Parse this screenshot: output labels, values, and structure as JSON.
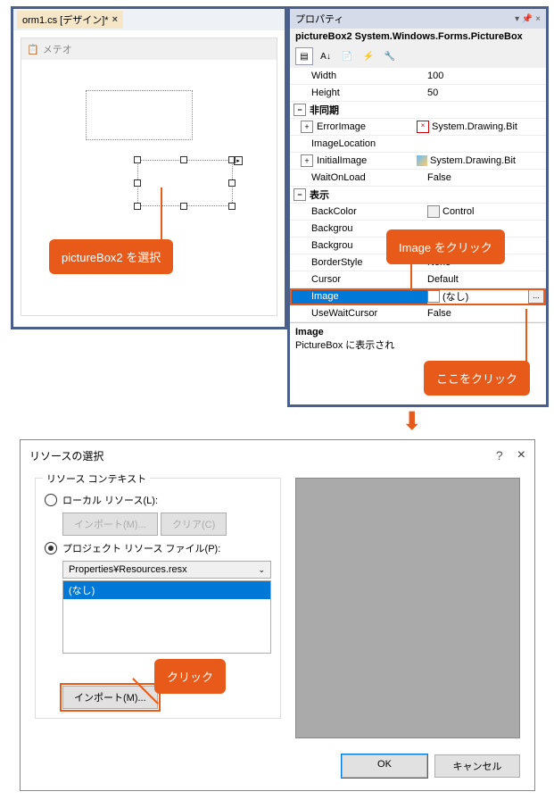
{
  "designer": {
    "tab_label": "orm1.cs [デザイン]*",
    "form_title": "メテオ"
  },
  "callouts": {
    "select_pb2": "pictureBox2 を選択",
    "image_click": "Image  をクリック",
    "click_here": "ここをクリック",
    "click": "クリック"
  },
  "properties": {
    "title": "プロパティ",
    "object": "pictureBox2  System.Windows.Forms.PictureBox",
    "rows": {
      "width_name": "Width",
      "width_val": "100",
      "height_name": "Height",
      "height_val": "50",
      "cat_async": "非同期",
      "errorimage_name": "ErrorImage",
      "errorimage_val": "System.Drawing.Bit",
      "imageloc_name": "ImageLocation",
      "imageloc_val": "",
      "initimage_name": "InitialImage",
      "initimage_val": "System.Drawing.Bit",
      "waitonload_name": "WaitOnLoad",
      "waitonload_val": "False",
      "cat_disp": "表示",
      "backcolor_name": "BackColor",
      "backcolor_val": "Control",
      "bgimg_name": "Backgrou",
      "bgimglayout_name": "Backgrou",
      "borderstyle_name": "BorderStyle",
      "borderstyle_val": "None",
      "cursor_name": "Cursor",
      "cursor_val": "Default",
      "image_name": "Image",
      "image_val": "(なし)",
      "usewait_name": "UseWaitCursor",
      "usewait_val": "False"
    },
    "desc_title": "Image",
    "desc_text": "PictureBox に表示され",
    "ellipsis": "..."
  },
  "dialog": {
    "title": "リソースの選択",
    "group_title": "リソース コンテキスト",
    "radio_local": "ローカル リソース(L):",
    "radio_proj": "プロジェクト リソース ファイル(P):",
    "btn_import": "インポート(M)...",
    "btn_clear": "クリア(C)",
    "combo_val": "Properties¥Resources.resx",
    "list_item_none": "(なし)",
    "btn_ok": "OK",
    "btn_cancel": "キャンセル",
    "help": "?",
    "close": "×"
  }
}
